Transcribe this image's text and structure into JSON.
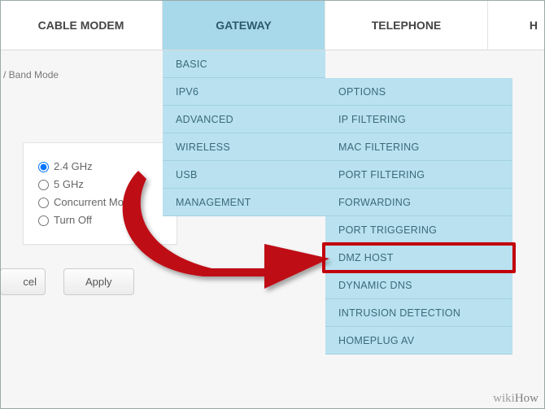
{
  "topnav": {
    "tabs": [
      "CABLE MODEM",
      "GATEWAY",
      "TELEPHONE",
      "H"
    ],
    "active_index": 1
  },
  "breadcrumb_tail": "/ Band Mode",
  "radios": {
    "options": [
      "2.4 GHz",
      "5 GHz",
      "Concurrent Mode",
      "Turn Off"
    ],
    "selected_index": 0
  },
  "buttons": {
    "cancel_partial": "cel",
    "apply": "Apply"
  },
  "gateway_menu": [
    "BASIC",
    "IPV6",
    "ADVANCED",
    "WIRELESS",
    "USB",
    "MANAGEMENT"
  ],
  "advanced_menu": [
    "OPTIONS",
    "IP FILTERING",
    "MAC FILTERING",
    "PORT FILTERING",
    "FORWARDING",
    "PORT TRIGGERING",
    "DMZ HOST",
    "DYNAMIC DNS",
    "INTRUSION DETECTION",
    "HOMEPLUG AV"
  ],
  "highlight_target": "DMZ HOST",
  "watermark": {
    "prefix": "wiki",
    "suffix": "How"
  },
  "colors": {
    "menu_bg": "#b9e1ef",
    "highlight": "#c2000b",
    "arrow": "#bf0a12"
  }
}
